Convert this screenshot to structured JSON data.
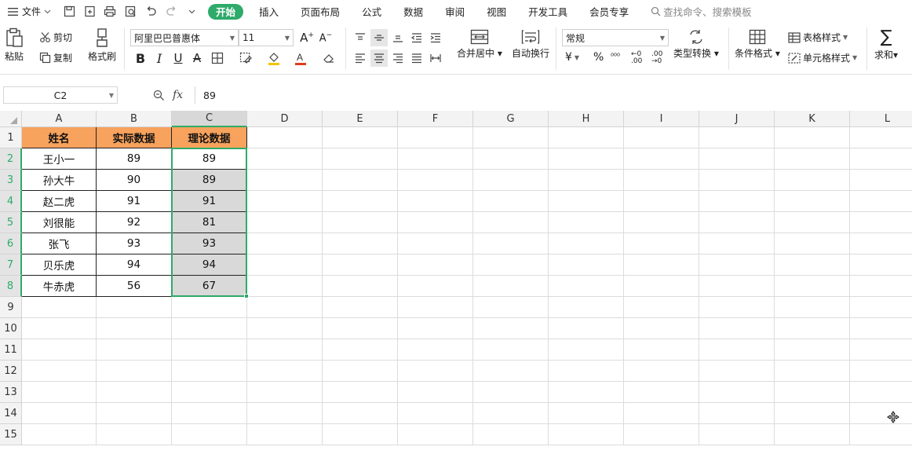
{
  "menu": {
    "file_label": "文件",
    "tabs": [
      "开始",
      "插入",
      "页面布局",
      "公式",
      "数据",
      "审阅",
      "视图",
      "开发工具",
      "会员专享"
    ],
    "search_placeholder": "查找命令、搜索模板"
  },
  "ribbon": {
    "paste": "粘贴",
    "cut": "剪切",
    "copy": "复制",
    "format_painter": "格式刷",
    "font_name": "阿里巴巴普惠体",
    "font_size": "11",
    "merge_center": "合并居中",
    "wrap_text": "自动换行",
    "number_format": "常规",
    "currency_symbol": "¥",
    "percent_symbol": "%",
    "type_convert": "类型转换",
    "conditional_format": "条件格式",
    "table_style": "表格样式",
    "cell_style": "单元格样式",
    "sum": "求和",
    "accent_color": "#2eaa6a",
    "font_color_bar": "#e03c1f",
    "fill_color_bar": "#f5c400"
  },
  "formula_bar": {
    "cell_ref": "C2",
    "fx_label": "fx",
    "value": "89"
  },
  "sheet": {
    "columns": [
      "A",
      "B",
      "C",
      "D",
      "E",
      "F",
      "G",
      "H",
      "I",
      "J",
      "K",
      "L"
    ],
    "selected_column": "C",
    "rows": [
      "1",
      "2",
      "3",
      "4",
      "5",
      "6",
      "7",
      "8",
      "9",
      "10",
      "11",
      "12",
      "13",
      "14",
      "15"
    ],
    "selected_rows": [
      "2",
      "3",
      "4",
      "5",
      "6",
      "7",
      "8"
    ],
    "header_fill": "#f7a25d",
    "selection_fill": "#d9d9d9",
    "table": {
      "headers": [
        "姓名",
        "实际数据",
        "理论数据"
      ],
      "rows": [
        [
          "王小一",
          "89",
          "89"
        ],
        [
          "孙大牛",
          "90",
          "89"
        ],
        [
          "赵二虎",
          "91",
          "91"
        ],
        [
          "刘很能",
          "92",
          "81"
        ],
        [
          "张飞",
          "93",
          "93"
        ],
        [
          "贝乐虎",
          "94",
          "94"
        ],
        [
          "牛赤虎",
          "56",
          "67"
        ]
      ]
    }
  }
}
